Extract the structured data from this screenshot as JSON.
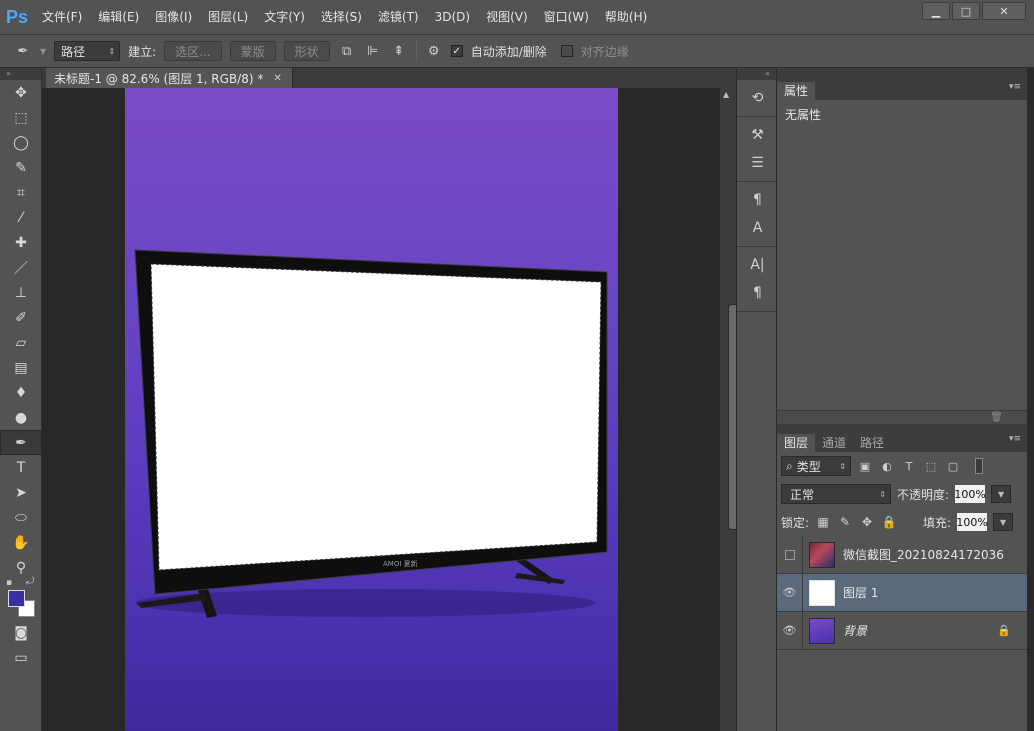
{
  "menubar": {
    "logo": "Ps",
    "items": [
      "文件(F)",
      "编辑(E)",
      "图像(I)",
      "图层(L)",
      "文字(Y)",
      "选择(S)",
      "滤镜(T)",
      "3D(D)",
      "视图(V)",
      "窗口(W)",
      "帮助(H)"
    ],
    "window_controls": [
      "▁",
      "□",
      "✕"
    ]
  },
  "options": {
    "mode": "路径",
    "make_label": "建立:",
    "selection_btn": "选区...",
    "mask_btn": "蒙版",
    "shape_btn": "形状",
    "auto_add_delete": "自动添加/删除",
    "align_edges": "对齐边缘"
  },
  "document": {
    "tab_title": "未标题-1 @ 82.6% (图层 1, RGB/8) *",
    "tv_brand": "AMOI 夏新"
  },
  "properties_panel": {
    "tab": "属性",
    "body": "无属性"
  },
  "layers_panel": {
    "tabs": [
      "图层",
      "通道",
      "路径"
    ],
    "filter_type": "类型",
    "blend_mode": "正常",
    "opacity_label": "不透明度:",
    "opacity_value": "100%",
    "lock_label": "锁定:",
    "fill_label": "填充:",
    "fill_value": "100%",
    "layers": [
      {
        "name": "微信截图_20210824172036",
        "visible": false,
        "selected": false
      },
      {
        "name": "图层 1",
        "visible": true,
        "selected": true
      },
      {
        "name": "背景",
        "visible": true,
        "selected": false,
        "locked": true
      }
    ]
  },
  "colors": {
    "foreground": "#3a2ea8",
    "background": "#ffffff",
    "accent_selected_layer": "#5a6a7c"
  }
}
